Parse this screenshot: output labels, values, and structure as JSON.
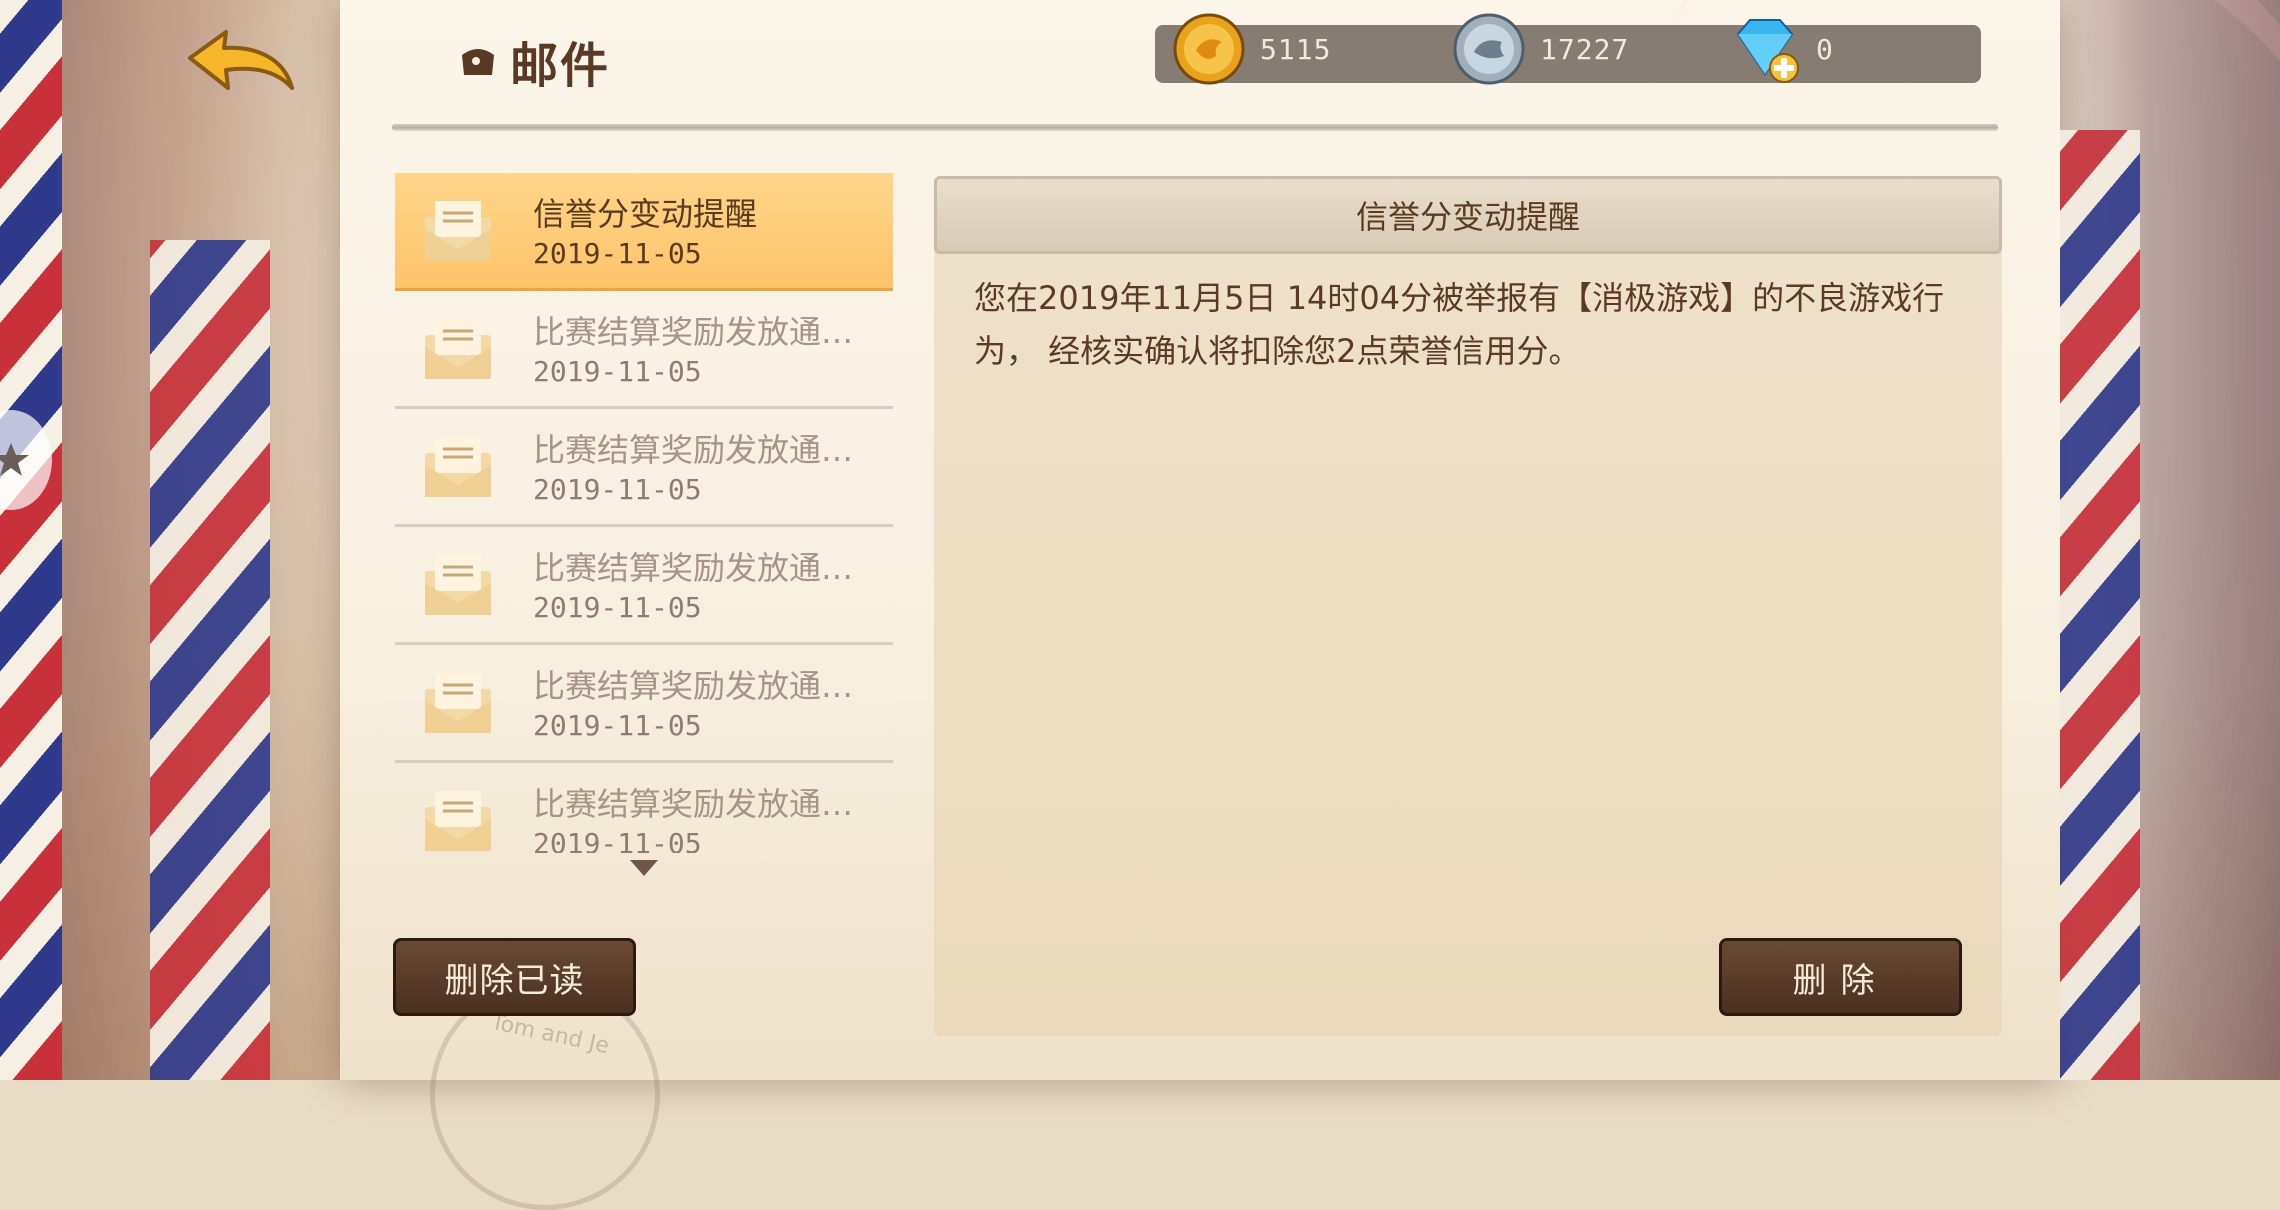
{
  "header": {
    "title": "邮件"
  },
  "currency": {
    "gold": "5115",
    "silver": "17227",
    "gems": "0"
  },
  "mail_list": {
    "items": [
      {
        "title": "信誉分变动提醒",
        "date": "2019-11-05",
        "selected": true
      },
      {
        "title": "比赛结算奖励发放通…",
        "date": "2019-11-05",
        "selected": false
      },
      {
        "title": "比赛结算奖励发放通…",
        "date": "2019-11-05",
        "selected": false
      },
      {
        "title": "比赛结算奖励发放通…",
        "date": "2019-11-05",
        "selected": false
      },
      {
        "title": "比赛结算奖励发放通…",
        "date": "2019-11-05",
        "selected": false
      },
      {
        "title": "比赛结算奖励发放通…",
        "date": "2019-11-05",
        "selected": false
      }
    ]
  },
  "detail": {
    "title": "信誉分变动提醒",
    "body": "您在2019年11月5日 14时04分被举报有【消极游戏】的不良游戏行为， 经核实确认将扣除您2点荣誉信用分。"
  },
  "buttons": {
    "delete_read": "删除已读",
    "delete": "删除"
  },
  "stamp": "Tom and Je"
}
